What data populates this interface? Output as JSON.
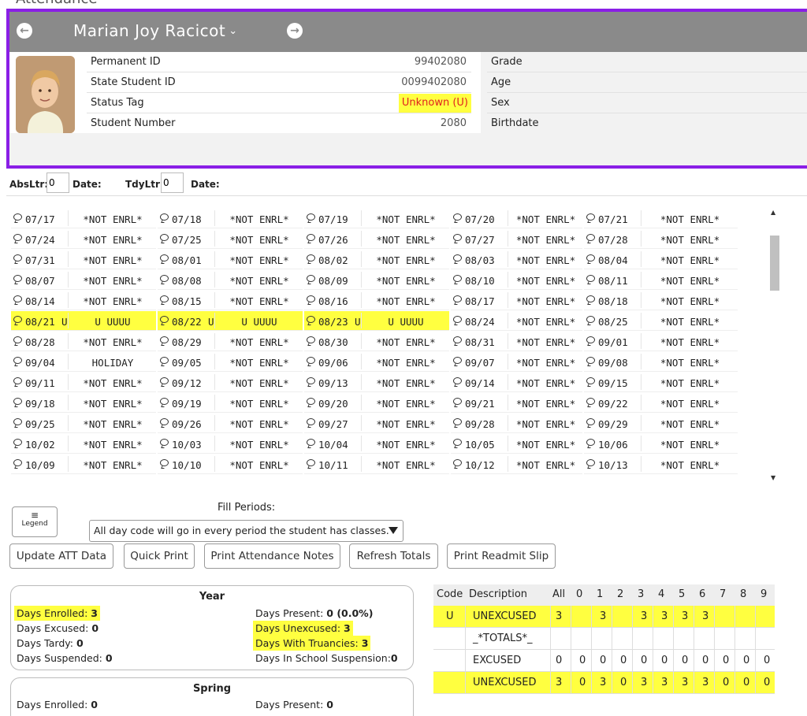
{
  "page": {
    "heading": "Attendance"
  },
  "student": {
    "name": "Marian Joy Racicot",
    "prev_icon": "arrow-left-circle-icon",
    "next_icon": "arrow-right-circle-icon",
    "fields": [
      {
        "label": "Permanent ID",
        "value": "99402080"
      },
      {
        "label": "State Student ID",
        "value": "0099402080"
      },
      {
        "label": "Status Tag",
        "value": "Unknown (U)"
      },
      {
        "label": "Student Number",
        "value": "2080"
      }
    ],
    "right_fields": [
      "Grade",
      "Age",
      "Sex",
      "Birthdate"
    ]
  },
  "letters": {
    "abs_label": "AbsLtr:",
    "abs_value": "0",
    "date1_label": "Date:",
    "tdy_label": "TdyLtr:",
    "tdy_value": "0",
    "date2_label": "Date:"
  },
  "calendar": [
    [
      [
        "07/17",
        "",
        "*NOT ENRL*"
      ],
      [
        "07/18",
        "",
        "*NOT ENRL*"
      ],
      [
        "07/19",
        "",
        "*NOT ENRL*"
      ],
      [
        "07/20",
        "",
        "*NOT ENRL*"
      ],
      [
        "07/21",
        "",
        "*NOT ENRL*"
      ]
    ],
    [
      [
        "07/24",
        "",
        "*NOT ENRL*"
      ],
      [
        "07/25",
        "",
        "*NOT ENRL*"
      ],
      [
        "07/26",
        "",
        "*NOT ENRL*"
      ],
      [
        "07/27",
        "",
        "*NOT ENRL*"
      ],
      [
        "07/28",
        "",
        "*NOT ENRL*"
      ]
    ],
    [
      [
        "07/31",
        "",
        "*NOT ENRL*"
      ],
      [
        "08/01",
        "",
        "*NOT ENRL*"
      ],
      [
        "08/02",
        "",
        "*NOT ENRL*"
      ],
      [
        "08/03",
        "",
        "*NOT ENRL*"
      ],
      [
        "08/04",
        "",
        "*NOT ENRL*"
      ]
    ],
    [
      [
        "08/07",
        "",
        "*NOT ENRL*"
      ],
      [
        "08/08",
        "",
        "*NOT ENRL*"
      ],
      [
        "08/09",
        "",
        "*NOT ENRL*"
      ],
      [
        "08/10",
        "",
        "*NOT ENRL*"
      ],
      [
        "08/11",
        "",
        "*NOT ENRL*"
      ]
    ],
    [
      [
        "08/14",
        "",
        "*NOT ENRL*"
      ],
      [
        "08/15",
        "",
        "*NOT ENRL*"
      ],
      [
        "08/16",
        "",
        "*NOT ENRL*"
      ],
      [
        "08/17",
        "",
        "*NOT ENRL*"
      ],
      [
        "08/18",
        "",
        "*NOT ENRL*"
      ]
    ],
    [
      [
        "08/21",
        "U",
        "U UUUU"
      ],
      [
        "08/22",
        "U",
        "U UUUU"
      ],
      [
        "08/23",
        "U",
        "U UUUU"
      ],
      [
        "08/24",
        "",
        "*NOT ENRL*"
      ],
      [
        "08/25",
        "",
        "*NOT ENRL*"
      ]
    ],
    [
      [
        "08/28",
        "",
        "*NOT ENRL*"
      ],
      [
        "08/29",
        "",
        "*NOT ENRL*"
      ],
      [
        "08/30",
        "",
        "*NOT ENRL*"
      ],
      [
        "08/31",
        "",
        "*NOT ENRL*"
      ],
      [
        "09/01",
        "",
        "*NOT ENRL*"
      ]
    ],
    [
      [
        "09/04",
        "",
        "HOLIDAY"
      ],
      [
        "09/05",
        "",
        "*NOT ENRL*"
      ],
      [
        "09/06",
        "",
        "*NOT ENRL*"
      ],
      [
        "09/07",
        "",
        "*NOT ENRL*"
      ],
      [
        "09/08",
        "",
        "*NOT ENRL*"
      ]
    ],
    [
      [
        "09/11",
        "",
        "*NOT ENRL*"
      ],
      [
        "09/12",
        "",
        "*NOT ENRL*"
      ],
      [
        "09/13",
        "",
        "*NOT ENRL*"
      ],
      [
        "09/14",
        "",
        "*NOT ENRL*"
      ],
      [
        "09/15",
        "",
        "*NOT ENRL*"
      ]
    ],
    [
      [
        "09/18",
        "",
        "*NOT ENRL*"
      ],
      [
        "09/19",
        "",
        "*NOT ENRL*"
      ],
      [
        "09/20",
        "",
        "*NOT ENRL*"
      ],
      [
        "09/21",
        "",
        "*NOT ENRL*"
      ],
      [
        "09/22",
        "",
        "*NOT ENRL*"
      ]
    ],
    [
      [
        "09/25",
        "",
        "*NOT ENRL*"
      ],
      [
        "09/26",
        "",
        "*NOT ENRL*"
      ],
      [
        "09/27",
        "",
        "*NOT ENRL*"
      ],
      [
        "09/28",
        "",
        "*NOT ENRL*"
      ],
      [
        "09/29",
        "",
        "*NOT ENRL*"
      ]
    ],
    [
      [
        "10/02",
        "",
        "*NOT ENRL*"
      ],
      [
        "10/03",
        "",
        "*NOT ENRL*"
      ],
      [
        "10/04",
        "",
        "*NOT ENRL*"
      ],
      [
        "10/05",
        "",
        "*NOT ENRL*"
      ],
      [
        "10/06",
        "",
        "*NOT ENRL*"
      ]
    ],
    [
      [
        "10/09",
        "",
        "*NOT ENRL*"
      ],
      [
        "10/10",
        "",
        "*NOT ENRL*"
      ],
      [
        "10/11",
        "",
        "*NOT ENRL*"
      ],
      [
        "10/12",
        "",
        "*NOT ENRL*"
      ],
      [
        "10/13",
        "",
        "*NOT ENRL*"
      ]
    ]
  ],
  "controls": {
    "legend_label": "Legend",
    "legend_icon": "list-icon",
    "fill_label": "Fill Periods:",
    "fill_value": "All day code will go in every period the student has classes.",
    "buttons": [
      "Update ATT Data",
      "Quick Print",
      "Print Attendance Notes",
      "Refresh Totals",
      "Print Readmit Slip"
    ]
  },
  "summary": {
    "year": {
      "title": "Year",
      "enrolled_label": "Days Enrolled:",
      "enrolled": "3",
      "excused_label": "Days Excused:",
      "excused": "0",
      "tardy_label": "Days Tardy:",
      "tardy": "0",
      "suspended_label": "Days Suspended:",
      "suspended": "0",
      "present_label": "Days Present:",
      "present": "0 (0.0%)",
      "unexcused_label": "Days Unexcused:",
      "unexcused": "3",
      "truancies_label": "Days With Truancies:",
      "truancies": "3",
      "iss_label": "Days In School Suspension:",
      "iss": "0"
    },
    "spring": {
      "title": "Spring",
      "enrolled_label": "Days Enrolled:",
      "enrolled": "0",
      "present_label": "Days Present:",
      "present": "0"
    }
  },
  "codes": {
    "headers": [
      "Code",
      "Description",
      "All",
      "0",
      "1",
      "2",
      "3",
      "4",
      "5",
      "6",
      "7",
      "8",
      "9"
    ],
    "rows": [
      [
        "U",
        "UNEXCUSED",
        "3",
        "",
        "3",
        "",
        "3",
        "3",
        "3",
        "3",
        "",
        "",
        ""
      ],
      [
        "",
        "_*TOTALS*_",
        "",
        "",
        "",
        "",
        "",
        "",
        "",
        "",
        "",
        "",
        ""
      ],
      [
        "",
        "EXCUSED",
        "0",
        "0",
        "0",
        "0",
        "0",
        "0",
        "0",
        "0",
        "0",
        "0",
        "0"
      ],
      [
        "",
        "UNEXCUSED",
        "3",
        "0",
        "3",
        "0",
        "3",
        "3",
        "3",
        "3",
        "0",
        "0",
        "0"
      ]
    ]
  },
  "colors": {
    "accent_border": "#8a1fe6",
    "highlight": "#ffff40",
    "status_text": "#e02020",
    "header_bar": "#8a8a8a"
  }
}
